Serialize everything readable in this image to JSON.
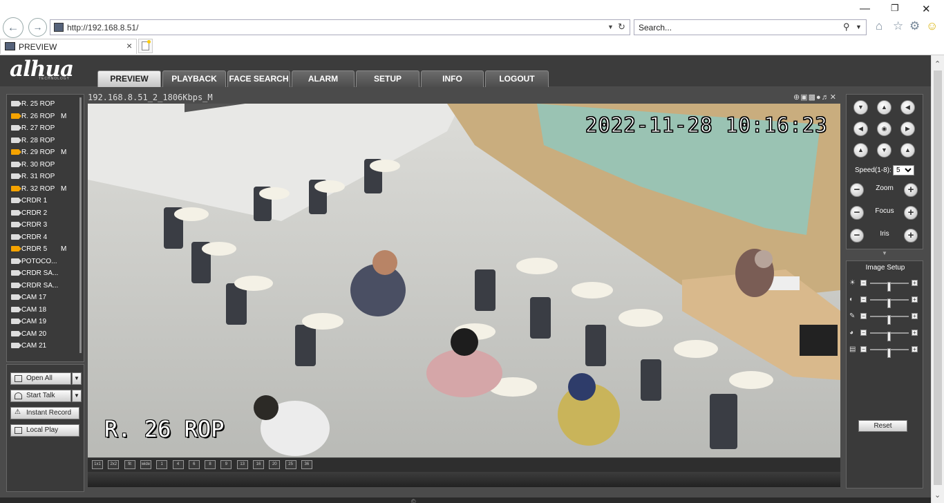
{
  "browser": {
    "url_host": "http://192.168.8.51/",
    "search_placeholder": "Search...",
    "tab_title": "PREVIEW"
  },
  "app": {
    "logo": "alhua",
    "logo_sub": "TECHNOLOGY",
    "nav": [
      "PREVIEW",
      "PLAYBACK",
      "FACE SEARCH",
      "ALARM",
      "SETUP",
      "INFO",
      "LOGOUT"
    ],
    "active_nav": "PREVIEW"
  },
  "cameras": [
    {
      "name": "R. 25 ROP",
      "active": false,
      "flag": ""
    },
    {
      "name": "R. 26 ROP",
      "active": true,
      "flag": "M"
    },
    {
      "name": "R. 27 ROP",
      "active": false,
      "flag": ""
    },
    {
      "name": "R. 28 ROP",
      "active": false,
      "flag": ""
    },
    {
      "name": "R. 29 ROP",
      "active": true,
      "flag": "M"
    },
    {
      "name": "R. 30 ROP",
      "active": false,
      "flag": ""
    },
    {
      "name": "R. 31 ROP",
      "active": false,
      "flag": ""
    },
    {
      "name": "R. 32 ROP",
      "active": true,
      "flag": "M"
    },
    {
      "name": "CRDR 1",
      "active": false,
      "flag": ""
    },
    {
      "name": "CRDR 2",
      "active": false,
      "flag": ""
    },
    {
      "name": "CRDR 3",
      "active": false,
      "flag": ""
    },
    {
      "name": "CRDR 4",
      "active": false,
      "flag": ""
    },
    {
      "name": "CRDR 5",
      "active": true,
      "flag": "M"
    },
    {
      "name": "POTOCO...",
      "active": false,
      "flag": ""
    },
    {
      "name": "CRDR SA...",
      "active": false,
      "flag": ""
    },
    {
      "name": "CRDR SA...",
      "active": false,
      "flag": ""
    },
    {
      "name": "CAM 17",
      "active": false,
      "flag": ""
    },
    {
      "name": "CAM 18",
      "active": false,
      "flag": ""
    },
    {
      "name": "CAM 19",
      "active": false,
      "flag": ""
    },
    {
      "name": "CAM 20",
      "active": false,
      "flag": ""
    },
    {
      "name": "CAM 21",
      "active": false,
      "flag": ""
    }
  ],
  "left_buttons": {
    "open_all": "Open All",
    "start_talk": "Start Talk",
    "instant_record": "Instant Record",
    "local_play": "Local Play"
  },
  "video": {
    "stream_title": "192.168.8.51_2_1806Kbps_M",
    "osd_time": "2022-11-28 10:16:23",
    "osd_name": "R. 26 ROP"
  },
  "layouts": [
    "1x1",
    "2x2",
    "fit",
    "wide",
    "1",
    "4",
    "6",
    "8",
    "9",
    "13",
    "16",
    "20",
    "25",
    "36"
  ],
  "ptz": {
    "speed_label": "Speed(1-8):",
    "speed_value": "5",
    "zoom": "Zoom",
    "focus": "Focus",
    "iris": "Iris"
  },
  "image_setup": {
    "title": "Image Setup",
    "reset": "Reset",
    "sliders": [
      {
        "icon": "brightness-icon",
        "value": 0.5
      },
      {
        "icon": "contrast-icon",
        "value": 0.5
      },
      {
        "icon": "saturation-icon",
        "value": 0.5
      },
      {
        "icon": "hue-icon",
        "value": 0.5
      },
      {
        "icon": "gain-icon",
        "value": 0.5
      }
    ]
  },
  "colors": {
    "active_camera": "#f5a300",
    "panel_bg": "#3a3a3a",
    "page_bg": "#4b4b4b"
  }
}
